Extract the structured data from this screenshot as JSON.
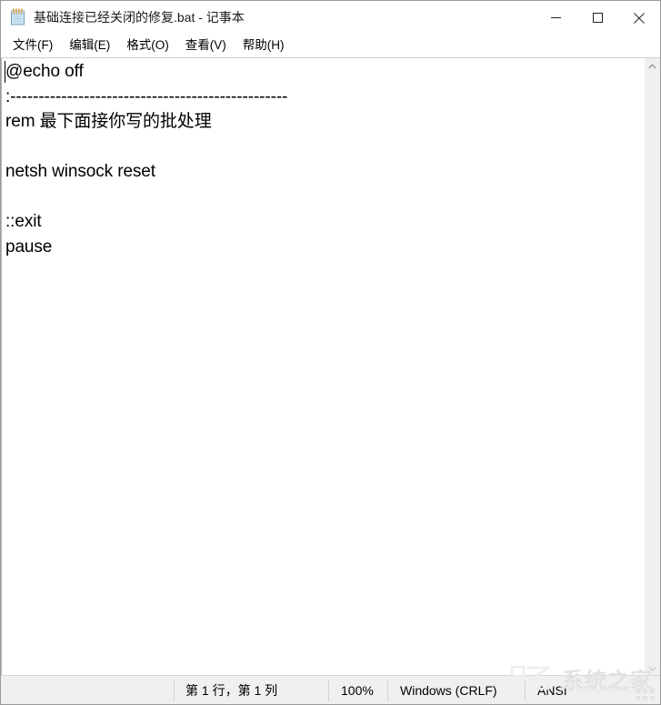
{
  "window": {
    "title": "基础连接已经关闭的修复.bat - 记事本",
    "icon": "notepad-icon"
  },
  "controls": {
    "minimize": "minimize-icon",
    "maximize": "maximize-icon",
    "close": "close-icon"
  },
  "menubar": {
    "items": [
      {
        "label": "文件(F)"
      },
      {
        "label": "编辑(E)"
      },
      {
        "label": "格式(O)"
      },
      {
        "label": "查看(V)"
      },
      {
        "label": "帮助(H)"
      }
    ]
  },
  "editor": {
    "content": "@echo off\n:-------------------------------------------------\nrem 最下面接你写的批处理\n\nnetsh winsock reset\n\n::exit\npause",
    "caret_visible": true
  },
  "scrollbar": {
    "up_arrow": "chevron-up-icon",
    "down_arrow": "chevron-down-icon"
  },
  "statusbar": {
    "line_col": "第 1 行，第 1 列",
    "zoom": "100%",
    "line_ending": "Windows (CRLF)",
    "encoding": "ANSI"
  },
  "watermark": {
    "cn": "系统之家",
    "en": "XITONGZHIJIA.NET"
  },
  "colors": {
    "window_bg": "#ffffff",
    "chrome_bg": "#f0f0f0",
    "border": "#9a9a9a",
    "text": "#000000",
    "watermark": "#e2e2e2"
  }
}
